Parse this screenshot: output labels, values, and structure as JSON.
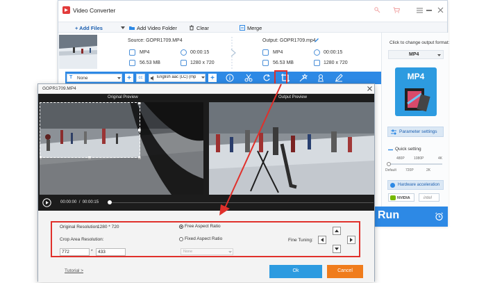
{
  "app": {
    "title": "Video Converter",
    "toolbar": {
      "add_files": "+ Add Files",
      "add_folder": "Add Video Folder",
      "clear": "Clear",
      "merge": "Merge"
    },
    "file": {
      "source_label": "Source: GOPR1709.MP4",
      "output_label": "Output: GOPR1709.mp4",
      "src_format": "MP4",
      "src_duration": "00:00:15",
      "src_size": "56.53 MB",
      "src_resolution": "1280 x 720",
      "out_format": "MP4",
      "out_duration": "00:00:15",
      "out_size": "56.53 MB",
      "out_resolution": "1280 x 720"
    },
    "opsbar": {
      "subtitle_value": "None",
      "audio_value": "English aac (LC) (mp"
    },
    "right_panel": {
      "hint": "Click to change output format:",
      "format": "MP4",
      "format_badge": "MP4",
      "param_settings": "Parameter settings",
      "quick_setting": "Quick setting",
      "q_top": [
        "480P",
        "1080P",
        "4K"
      ],
      "q_bottom": [
        "Default",
        "720P",
        "2K"
      ],
      "hw_accel": "Hardware acceleration",
      "nvidia": "NVIDIA",
      "intel": "intel"
    },
    "run": "Run"
  },
  "dialog": {
    "title": "GOPR1709.MP4",
    "original_preview": "Original Preview",
    "output_preview": "Output Preview",
    "time": "00:00:00  /  00:00:15",
    "original_resolution_label": "Original Resolution:",
    "original_resolution_value": "1280 * 720",
    "crop_area_label": "Crop Area Resolution:",
    "crop_w": "772",
    "crop_sep": "*",
    "crop_h": "433",
    "free_aspect": "Free Aspect Ratio",
    "fixed_aspect": "Fixed Aspect Ratio",
    "aspect_select": "None",
    "fine_tuning": "Fine Tuning:",
    "tutorial": "Tutorial >",
    "ok": "Ok",
    "cancel": "Cancel"
  },
  "colors": {
    "accent": "#2d89e5",
    "highlight_red": "#e0302b",
    "cancel_orange": "#f07c1c"
  }
}
